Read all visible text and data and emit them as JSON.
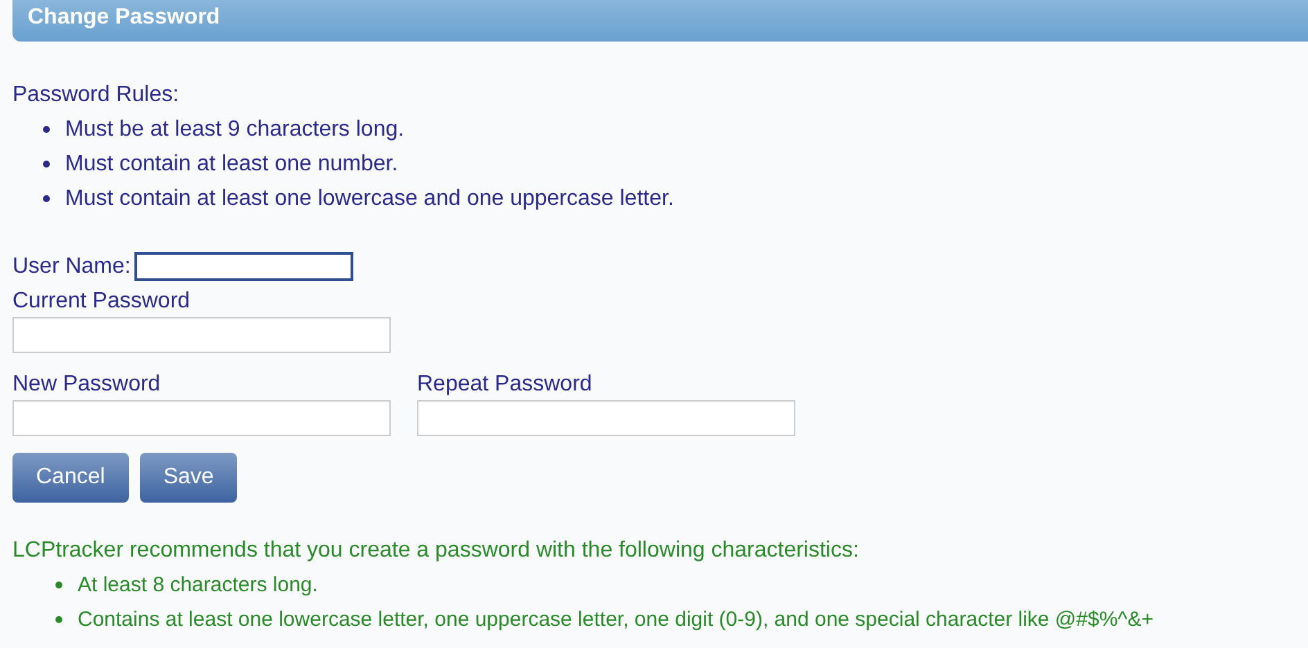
{
  "header": {
    "title": "Change Password"
  },
  "rules": {
    "heading": "Password Rules:",
    "items": [
      "Must be at least 9 characters long.",
      "Must contain at least one number.",
      "Must contain at least one lowercase and one uppercase letter."
    ]
  },
  "form": {
    "user_name": {
      "label": "User Name:",
      "focused": true
    },
    "current_password": {
      "label": "Current Password",
      "focused": false
    },
    "new_password": {
      "label": "New Password",
      "focused": false
    },
    "repeat_password": {
      "label": "Repeat Password",
      "focused": false
    }
  },
  "buttons": [
    "Cancel",
    "Save"
  ],
  "recommendations": {
    "intro": "LCPtracker recommends that you create a password with the following characteristics:",
    "items": [
      "At least 8 characters long.",
      "Contains at least one lowercase letter, one uppercase letter, one digit (0-9), and one special character like @#$%^&+"
    ]
  }
}
